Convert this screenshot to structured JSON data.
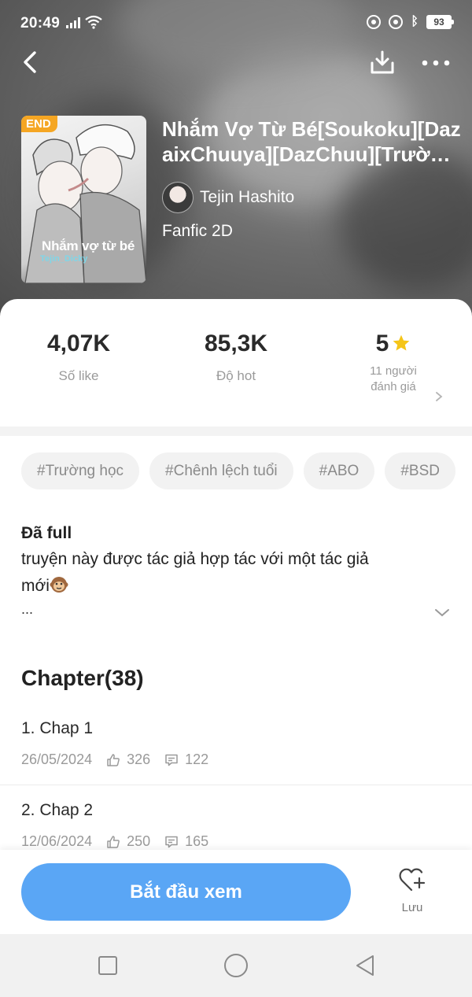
{
  "status_bar": {
    "time": "20:49",
    "battery": "93"
  },
  "book": {
    "badge": "END",
    "cover_title": "Nhắm vợ từ bé",
    "cover_subtitle": "Tejin_Dicky",
    "title": "Nhắm Vợ Từ Bé[Soukoku][DazaixChuuya][DazChuu][TrườnghọcABO]",
    "author": "Tejin Hashito",
    "category": "Fanfic 2D"
  },
  "stats": {
    "likes_value": "4,07K",
    "likes_label": "Số like",
    "hot_value": "85,3K",
    "hot_label": "Độ hot",
    "rating_value": "5",
    "rating_label_line1": "11 người",
    "rating_label_line2": "đánh giá"
  },
  "tags": [
    "#Trường học",
    "#Chênh lệch tuổi",
    "#ABO",
    "#BSD"
  ],
  "description": {
    "status": "Đã full",
    "text_line1": "truyện này được tác giả hợp tác với một tác giả",
    "text_line2": "mới",
    "ellipsis": "..."
  },
  "chapters": {
    "header": "Chapter(38)",
    "items": [
      {
        "name": "1. Chap 1",
        "date": "26/05/2024",
        "likes": "326",
        "comments": "122"
      },
      {
        "name": "2. Chap 2",
        "date": "12/06/2024",
        "likes": "250",
        "comments": "165"
      }
    ]
  },
  "actions": {
    "start_label": "Bắt đầu xem",
    "save_label": "Lưu"
  },
  "colors": {
    "accent": "#5aa6f5",
    "badge": "#f5a623",
    "star": "#f5c518"
  },
  "icons": [
    "back-icon",
    "download-icon",
    "more-icon",
    "star-icon",
    "chevron-right-icon",
    "chevron-down-icon",
    "like-icon",
    "comment-icon",
    "heart-plus-icon"
  ]
}
